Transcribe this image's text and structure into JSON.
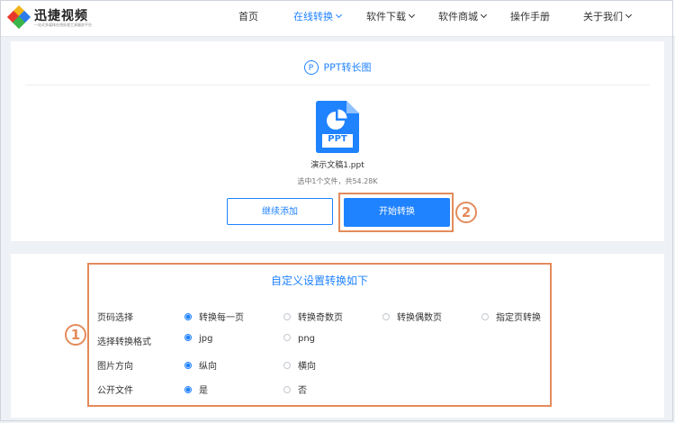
{
  "header": {
    "brand_name": "迅捷视频",
    "brand_tagline": "一站式多媒体在线处理工具服务平台",
    "nav": [
      {
        "label": "首页"
      },
      {
        "label": "在线转换"
      },
      {
        "label": "软件下载"
      },
      {
        "label": "软件商城"
      },
      {
        "label": "操作手册"
      },
      {
        "label": "关于我们"
      }
    ]
  },
  "converter": {
    "icon_letter": "P",
    "title": "PPT转长图",
    "file_badge": "PPT",
    "file_name": "演示文稿1.ppt",
    "file_info": "选中1个文件，共54.28K",
    "add_label": "继续添加",
    "start_label": "开始转换"
  },
  "settings": {
    "title": "自定义设置转换如下",
    "rows": [
      {
        "label": "页码选择",
        "options": [
          {
            "label": "转换每一页",
            "selected": true
          },
          {
            "label": "转换奇数页",
            "selected": false
          },
          {
            "label": "转换偶数页",
            "selected": false
          },
          {
            "label": "指定页转换",
            "selected": false
          }
        ]
      },
      {
        "label": "选择转换格式",
        "options": [
          {
            "label": "jpg",
            "selected": true
          },
          {
            "label": "png",
            "selected": false
          }
        ]
      },
      {
        "label": "图片方向",
        "options": [
          {
            "label": "纵向",
            "selected": true
          },
          {
            "label": "横向",
            "selected": false
          }
        ]
      },
      {
        "label": "公开文件",
        "options": [
          {
            "label": "是",
            "selected": true
          },
          {
            "label": "否",
            "selected": false
          }
        ]
      }
    ]
  },
  "annotations": {
    "badge_1": "1",
    "badge_2": "2"
  },
  "colors": {
    "accent": "#1f82ff",
    "highlight": "#e38b5b"
  }
}
